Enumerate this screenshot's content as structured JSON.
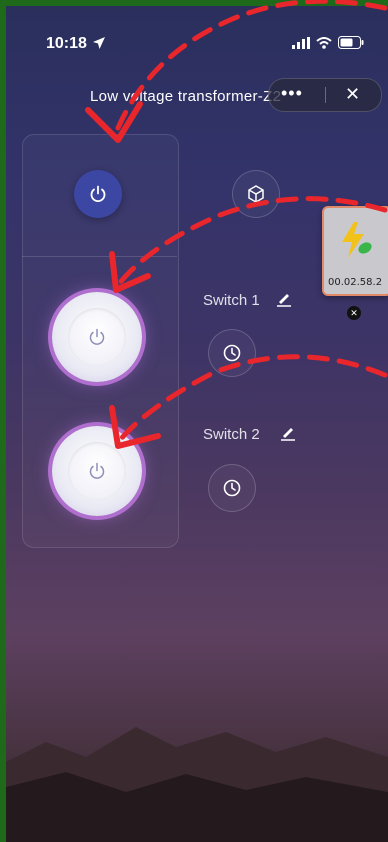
{
  "status_bar": {
    "time": "10:18"
  },
  "header": {
    "title": "Low voltage transformer-Z2",
    "more_glyph": "•••",
    "close_glyph": "✕"
  },
  "switches": [
    {
      "label": "Switch 1"
    },
    {
      "label": "Switch 2"
    }
  ],
  "floating_card": {
    "version": "00.02.58.2",
    "close_glyph": "✕"
  },
  "colors": {
    "master_button": "#3b47a2",
    "switch_ring": "#b06fcf",
    "annotation_arrow": "#e8262c",
    "background_top": "#2a2f5c",
    "background_bottom": "#2a2026"
  },
  "icons": [
    "location-arrow-icon",
    "signal-icon",
    "wifi-icon",
    "battery-icon",
    "power-icon",
    "cube-icon",
    "timer-icon",
    "edit-icon",
    "bolt-leaf-icon"
  ]
}
